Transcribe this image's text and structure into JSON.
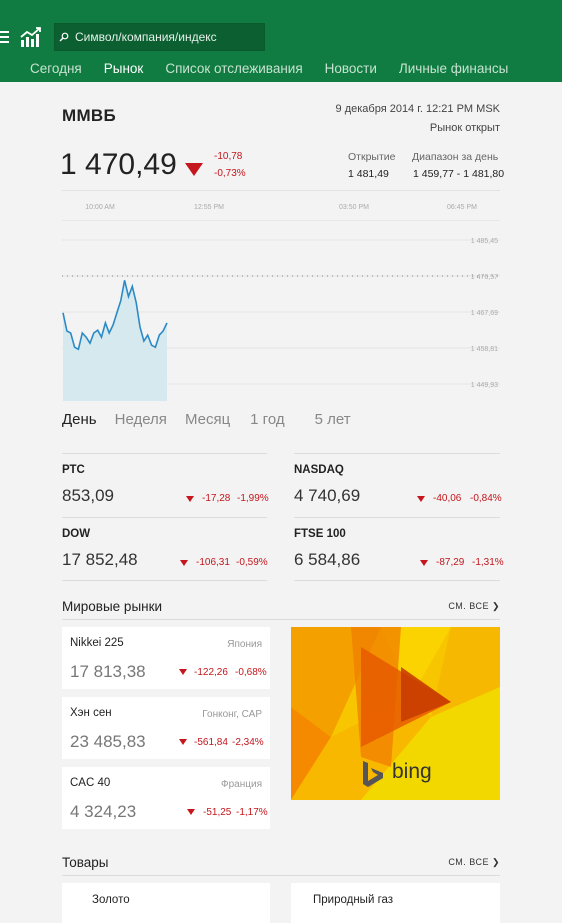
{
  "header": {
    "search_placeholder": "Символ/компания/индекс",
    "tabs": [
      {
        "label": "Сегодня",
        "active": false
      },
      {
        "label": "Рынок",
        "active": true
      },
      {
        "label": "Список отслеживания",
        "active": false
      },
      {
        "label": "Новости",
        "active": false
      },
      {
        "label": "Личные финансы",
        "active": false
      }
    ]
  },
  "quote": {
    "name": "ММВБ",
    "timestamp": "9 декабря 2014 г. 12:21 PM MSK",
    "status": "Рынок открыт",
    "price": "1 470,49",
    "change": "-10,78",
    "change_pct": "-0,73%",
    "open_label": "Открытие",
    "open_value": "1 481,49",
    "range_label": "Диапазон за день",
    "range_low": "1 459,77",
    "range_sep": "-",
    "range_high": "1 481,80"
  },
  "chart_data": {
    "type": "area",
    "x_tick_labels": [
      "10:00 AM",
      "12:55 PM",
      "03:50 PM",
      "06:45 PM"
    ],
    "y_tick_labels": [
      "1 485,45",
      "1 476,57",
      "1 467,69",
      "1 458,81",
      "1 449,93"
    ],
    "ylim": [
      1449.93,
      1485.45
    ],
    "reference_line": 1476.57,
    "series": [
      {
        "values": [
          1467.5,
          1463.0,
          1462.5,
          1459.0,
          1458.5,
          1462.5,
          1461.5,
          1460.0,
          1462.5,
          1463.2,
          1461.5,
          1465.0,
          1462.5,
          1464.5,
          1467.5,
          1470.5,
          1475.5,
          1471.5,
          1474.0,
          1470.0,
          1464.0,
          1460.5,
          1462.0,
          1459.5,
          1459.0,
          1462.0,
          1463.0,
          1465.0
        ]
      }
    ],
    "colors": {
      "line": "#2b8ac6",
      "fill": "#d6e9ef"
    }
  },
  "range_tabs": [
    {
      "label": "День",
      "active": true
    },
    {
      "label": "Неделя",
      "active": false
    },
    {
      "label": "Месяц",
      "active": false
    },
    {
      "label": "1 год",
      "active": false
    },
    {
      "label": "5 лет",
      "active": false
    }
  ],
  "indices": [
    {
      "name": "РТС",
      "value": "853,09",
      "change": "-17,28",
      "pct": "-1,99%"
    },
    {
      "name": "NASDAQ",
      "value": "4 740,69",
      "change": "-40,06",
      "pct": "-0,84%"
    },
    {
      "name": "DOW",
      "value": "17 852,48",
      "change": "-106,31",
      "pct": "-0,59%"
    },
    {
      "name": "FTSE 100",
      "value": "6 584,86",
      "change": "-87,29",
      "pct": "-1,31%"
    }
  ],
  "world_markets": {
    "title": "Мировые рынки",
    "see_all": "СМ. ВСЕ ❯",
    "items": [
      {
        "name": "Nikkei 225",
        "region": "Япония",
        "value": "17 813,38",
        "change": "-122,26",
        "pct": "-0,68%"
      },
      {
        "name": "Хэн сен",
        "region": "Гонконг, САР",
        "value": "23 485,83",
        "change": "-561,84",
        "pct": "-2,34%"
      },
      {
        "name": "CAC 40",
        "region": "Франция",
        "value": "4 324,23",
        "change": "-51,25",
        "pct": "-1,17%"
      }
    ],
    "ad_text": "bing"
  },
  "commodities": {
    "title": "Товары",
    "see_all": "СМ. ВСЕ ❯",
    "items": [
      {
        "name": "Золото"
      },
      {
        "name": "Природный газ"
      }
    ]
  },
  "colors": {
    "brand": "#107c41",
    "down": "#c4161c"
  }
}
